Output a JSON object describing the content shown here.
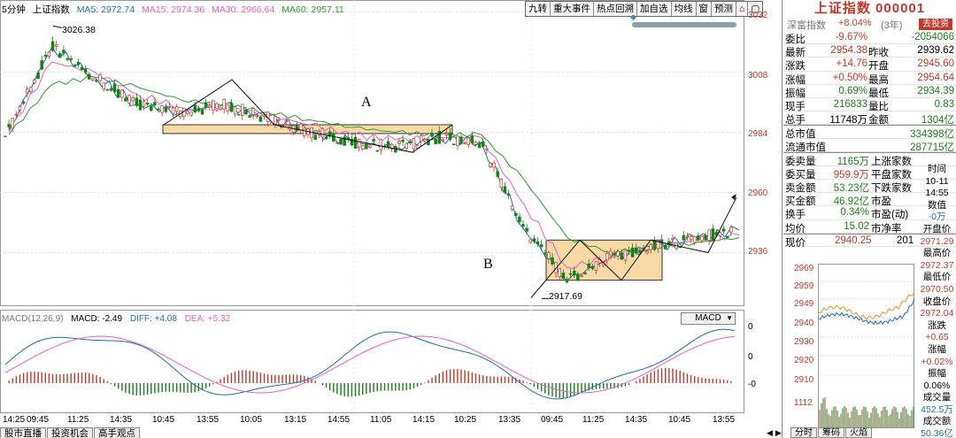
{
  "chart_header": {
    "period": "5分钟",
    "index_name": "上证指数",
    "ma5": "MA5: 2972.74",
    "ma15": "MA15: 2974.36",
    "ma30": "MA30: 2966.64",
    "ma60": "MA60: 2957.11"
  },
  "toolbar": [
    "九转",
    "重大事件",
    "热点回溯",
    "加自选",
    "均线",
    "窗",
    "预测",
    "⌂",
    "▢"
  ],
  "y_axis": [
    "3032",
    "3008",
    "2984",
    "2960",
    "2936"
  ],
  "macd_header": {
    "name": "MACD(12,26,9)",
    "macd": "MACD: -2.49",
    "diff": "DIFF: +4.08",
    "dea": "DEA: +5.32"
  },
  "macd_select": "MACD",
  "macd_axis": [
    "0",
    "0",
    "-0"
  ],
  "time_axis": [
    "14:25",
    "09:45",
    "11:25",
    "14:35",
    "10:45",
    "13:55",
    "10:05",
    "13:15",
    "14:55",
    "11:05",
    "14:15",
    "10:25",
    "13:35",
    "09:45",
    "11:25",
    "14:35",
    "10:45",
    "13:55"
  ],
  "annotations": {
    "label_a": "A",
    "label_b": "B",
    "high_price": "3026.38",
    "low_price": "2917.69"
  },
  "bottom_tabs": [
    "股市直播",
    "投资机会",
    "高手观点"
  ],
  "colors": {
    "up": "#c0392b",
    "down": "#1a7f1a",
    "ma5": "#1f6fa8",
    "ma15": "#e35fd0",
    "ma30": "#2e9b2e",
    "box_fill": "#f9d9a6"
  },
  "chart_data": {
    "type": "line",
    "x": [
      "14:25",
      "09:45",
      "11:25",
      "14:35",
      "10:45",
      "13:55",
      "10:05",
      "13:15",
      "14:55",
      "11:05",
      "14:15",
      "10:25",
      "13:35",
      "09:45",
      "11:25",
      "14:35",
      "10:45",
      "13:55"
    ],
    "series": [
      {
        "name": "MA5",
        "values": [
          2985,
          3018,
          3006,
          2995,
          2992,
          2995,
          2990,
          2984,
          2980,
          2978,
          2982,
          2980,
          2945,
          2925,
          2934,
          2938,
          2942,
          2945
        ]
      },
      {
        "name": "MA15",
        "values": [
          2984,
          3012,
          3008,
          2999,
          2994,
          2994,
          2991,
          2987,
          2983,
          2981,
          2982,
          2982,
          2955,
          2930,
          2934,
          2938,
          2941,
          2943
        ]
      },
      {
        "name": "MA30",
        "values": [
          2983,
          3003,
          3006,
          3002,
          2997,
          2995,
          2992,
          2989,
          2986,
          2984,
          2983,
          2983,
          2965,
          2942,
          2936,
          2938,
          2940,
          2942
        ]
      },
      {
        "name": "MA60",
        "values": [
          2978,
          2988,
          2998,
          3001,
          2999,
          2997,
          2995,
          2992,
          2989,
          2987,
          2985,
          2984,
          2975,
          2958,
          2946,
          2942,
          2940,
          2940
        ]
      }
    ],
    "ylim": [
      2915,
      3035
    ],
    "ylabel": "",
    "xlabel": ""
  },
  "side": {
    "title": "上证指数 000001",
    "sub_index": "深富指数",
    "sub_change": "+8.04%",
    "sub_year": "(3年)",
    "sub_button": "去投资",
    "rows": [
      {
        "l1": "委比",
        "v1": "-9.67%",
        "l2": "",
        "v2": "-2054066",
        "c1": "red",
        "c2": "green"
      },
      {
        "l1": "最新",
        "v1": "2954.38",
        "l2": "昨收",
        "v2": "2939.62",
        "c1": "red",
        "c2": ""
      },
      {
        "l1": "涨跌",
        "v1": "+14.76",
        "l2": "开盘",
        "v2": "2945.60",
        "c1": "red",
        "c2": "red"
      },
      {
        "l1": "涨幅",
        "v1": "+0.50%",
        "l2": "最高",
        "v2": "2954.64",
        "c1": "red",
        "c2": "red"
      },
      {
        "l1": "振幅",
        "v1": "0.69%",
        "l2": "最低",
        "v2": "2934.39",
        "c1": "green",
        "c2": "green"
      },
      {
        "l1": "现手",
        "v1": "216833",
        "l2": "量比",
        "v2": "0.83",
        "c1": "green",
        "c2": "green"
      },
      {
        "l1": "总手",
        "v1": "11748万",
        "l2": "金额",
        "v2": "1304亿",
        "c1": "",
        "c2": "green"
      }
    ],
    "market_value": {
      "label": "总市值",
      "value": "334398亿"
    },
    "float_value": {
      "label": "流通市值",
      "value": "287715亿"
    },
    "rows2": [
      {
        "l1": "委卖量",
        "v1": "1165万",
        "l2": "上涨家数",
        "c1": "green"
      },
      {
        "l1": "委买量",
        "v1": "959.9万",
        "l2": "平盘家数",
        "c1": "red"
      },
      {
        "l1": "卖金额",
        "v1": "53.23亿",
        "l2": "下跌家数",
        "c1": "green"
      },
      {
        "l1": "买金额",
        "v1": "46.92亿",
        "l2": "市盈",
        "c1": "green"
      },
      {
        "l1": "换手",
        "v1": "0.34%",
        "l2": "市盈(动)",
        "c1": "green"
      },
      {
        "l1": "均价",
        "v1": "15.02",
        "l2": "市净率",
        "c1": "green"
      }
    ],
    "now_price": {
      "label": "现价",
      "value": "2940.25",
      "extra": "201"
    },
    "mini_axis": [
      "2969",
      "2959",
      "2949",
      "2940",
      "2930",
      "2920",
      "2910",
      "1112"
    ],
    "side_list": [
      "时间",
      "10-11",
      "14:55",
      "数值",
      "-0万",
      "开盘价",
      "2971.29",
      "最高价",
      "2972.37",
      "最低价",
      "2970.50",
      "收盘价",
      "2972.04",
      "涨跌",
      "+0.65",
      "涨幅",
      "+0.02%",
      "振幅",
      "0.06%",
      "成交量",
      "452.5万",
      "成交额",
      "50.36亿"
    ],
    "tabs": [
      "分时",
      "筹码",
      "火焰"
    ]
  }
}
